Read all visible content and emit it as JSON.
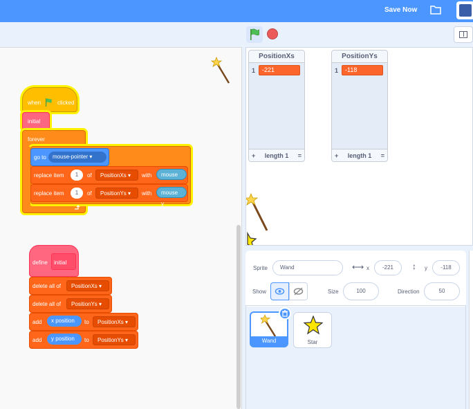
{
  "topbar": {
    "save_label": "Save Now"
  },
  "lists": [
    {
      "title": "PositionXs",
      "index": "1",
      "value": "-221",
      "plus": "+",
      "length_label": "length 1",
      "equals": "="
    },
    {
      "title": "PositionYs",
      "index": "1",
      "value": "-118",
      "plus": "+",
      "length_label": "length 1",
      "equals": "="
    }
  ],
  "sprite_info": {
    "sprite_label": "Sprite",
    "sprite_name": "Wand",
    "x_label": "x",
    "x_value": "-221",
    "y_label": "y",
    "y_value": "-118",
    "show_label": "Show",
    "size_label": "Size",
    "size_value": "100",
    "direction_label": "Direction",
    "direction_value": "50"
  },
  "sprites": [
    {
      "name": "Wand",
      "selected": true
    },
    {
      "name": "Star",
      "selected": false
    }
  ],
  "script1": {
    "when_label": "when",
    "clicked_label": "clicked",
    "initial_call": "initial",
    "forever_label": "forever",
    "goto_label": "go to",
    "goto_target": "mouse-pointer",
    "replace_label": "replace item",
    "of_label": "of",
    "with_label": "with",
    "item_index": "1",
    "list_x": "PositionXs",
    "list_y": "PositionYs",
    "mouse_x": "mouse x",
    "mouse_y": "mouse y"
  },
  "script2": {
    "define_label": "define",
    "define_name": "initial",
    "delete_all_label": "delete all of",
    "list_x": "PositionXs",
    "list_y": "PositionYs",
    "add_label": "add",
    "to_label": "to",
    "x_position": "x position",
    "y_position": "y position"
  }
}
